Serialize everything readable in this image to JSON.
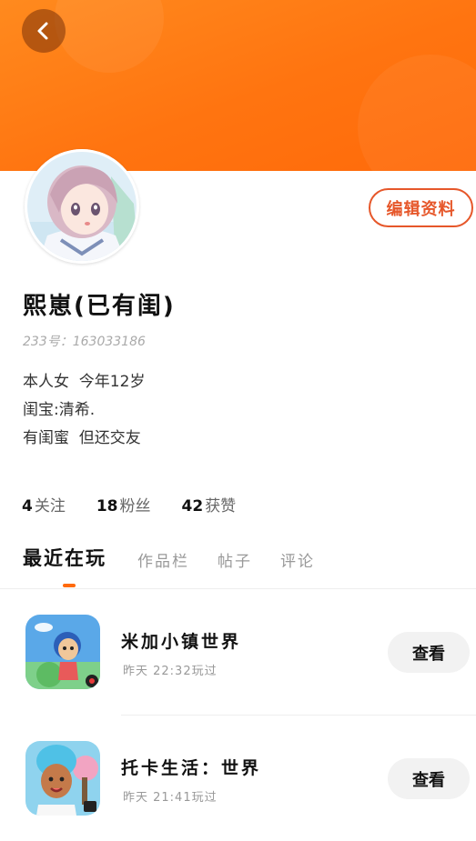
{
  "header": {
    "back_icon": "chevron-left-icon",
    "banner_color": "#ff7410"
  },
  "profile": {
    "avatar_icon": "avatar-anime-girl",
    "edit_label": "编辑资料",
    "nickname": "熙崽(已有闺)",
    "uid": "233号：163033186",
    "bio": [
      "本人女  今年12岁",
      "闺宝:清希.",
      "有闺蜜  但还交友"
    ],
    "accent": "#e6572a"
  },
  "stats": [
    {
      "count": "4",
      "label": "关注"
    },
    {
      "count": "18",
      "label": "粉丝"
    },
    {
      "count": "42",
      "label": "获赞"
    }
  ],
  "tabs": [
    "最近在玩",
    "作品栏",
    "帖子",
    "评论"
  ],
  "games": [
    {
      "title": "米加小镇世界",
      "time": "昨天 22:32玩过",
      "button": "查看",
      "icon": "miga-town-icon"
    },
    {
      "title": "托卡生活：世界",
      "time": "昨天 21:41玩过",
      "button": "查看",
      "icon": "toca-life-icon"
    }
  ]
}
